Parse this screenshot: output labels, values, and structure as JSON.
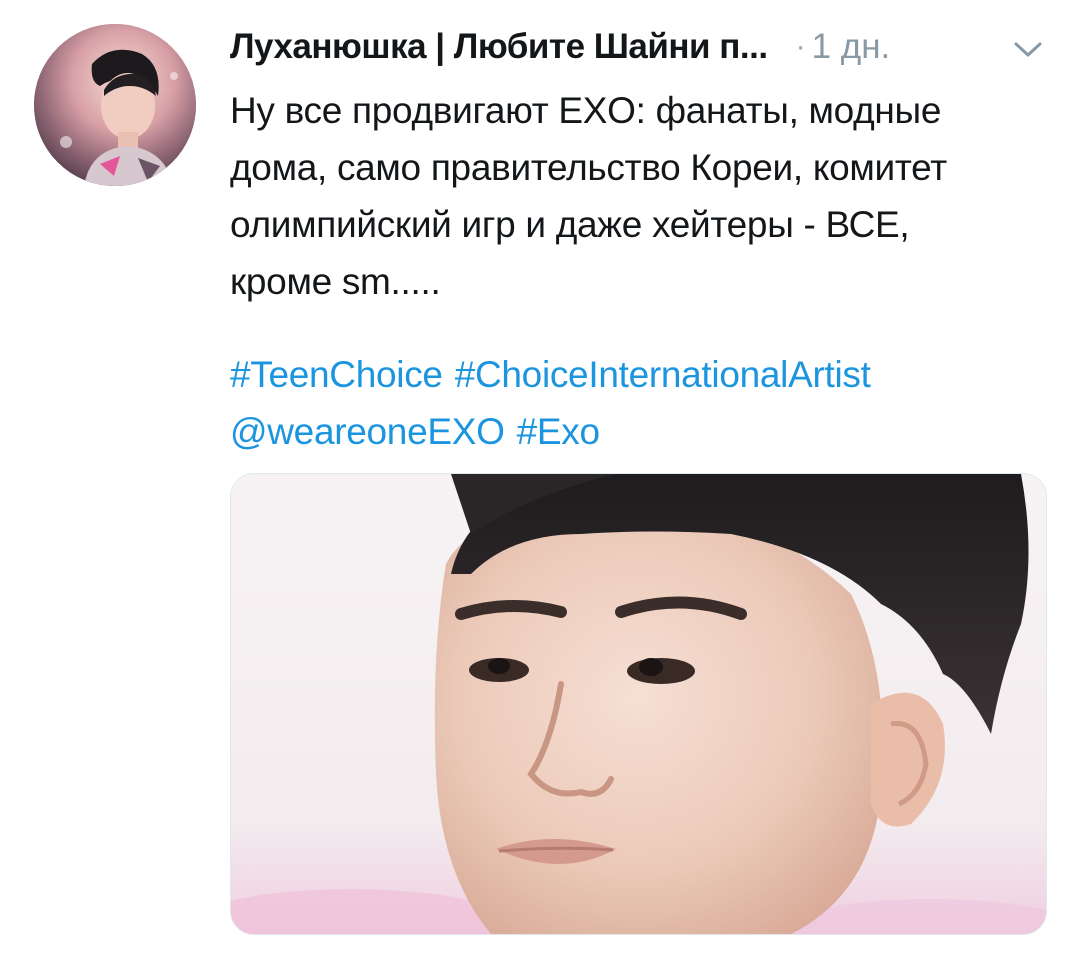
{
  "tweet": {
    "display_name": "Луханюшка | Любите Шайни п...",
    "separator": "·",
    "timestamp": "1 дн.",
    "text": "Ну все продвигают EXO: фанаты, модные\nдома, само правительство Кореи, комитет\nолимпийский игр и даже хейтеры - ВСЕ,\nкроме sm.....",
    "links_line1": [
      "#TeenChoice",
      "#ChoiceInternationalArtist"
    ],
    "links_line2": [
      "@weareoneEXO",
      "#Exo"
    ]
  },
  "colors": {
    "link": "#1b95e0",
    "text": "#14171a",
    "muted": "#8899a6"
  },
  "icons": {
    "caret": "chevron-down-icon"
  }
}
